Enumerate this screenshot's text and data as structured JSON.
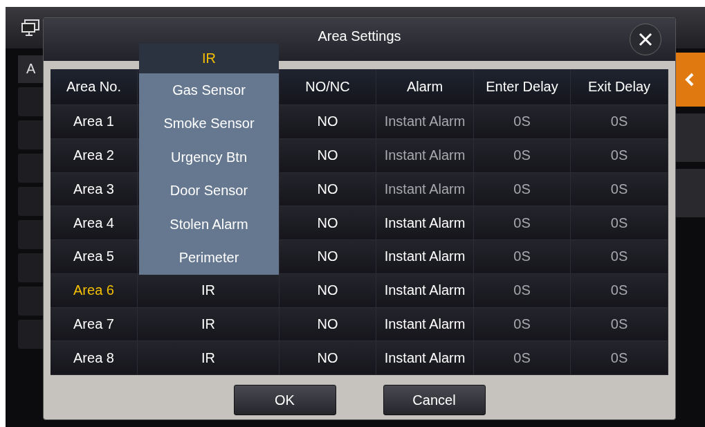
{
  "background": {
    "tab_label": "A"
  },
  "dialog": {
    "title": "Area Settings",
    "table": {
      "columns": [
        "Area No.",
        "NO/NC",
        "Alarm",
        "Enter Delay",
        "Exit Delay"
      ],
      "rows": [
        {
          "area": "Area 1",
          "no_nc": "NO",
          "alarm": {
            "text": "Instant Alarm",
            "dimmed": true
          },
          "enter_delay": "0S",
          "exit_delay": "0S",
          "selected": false
        },
        {
          "area": "Area 2",
          "no_nc": "NO",
          "alarm": {
            "text": "Instant Alarm",
            "dimmed": true
          },
          "enter_delay": "0S",
          "exit_delay": "0S",
          "selected": false
        },
        {
          "area": "Area 3",
          "no_nc": "NO",
          "alarm": {
            "text": "Instant Alarm",
            "dimmed": true
          },
          "enter_delay": "0S",
          "exit_delay": "0S",
          "selected": false
        },
        {
          "area": "Area 4",
          "no_nc": "NO",
          "alarm": {
            "text": "Instant Alarm",
            "dimmed": false
          },
          "enter_delay": "0S",
          "exit_delay": "0S",
          "selected": false
        },
        {
          "area": "Area 5",
          "no_nc": "NO",
          "alarm": {
            "text": "Instant Alarm",
            "dimmed": false
          },
          "enter_delay": "0S",
          "exit_delay": "0S",
          "selected": false
        },
        {
          "area": "Area 6",
          "type": "IR",
          "no_nc": "NO",
          "alarm": {
            "text": "Instant Alarm",
            "dimmed": false
          },
          "enter_delay": "0S",
          "exit_delay": "0S",
          "selected": true
        },
        {
          "area": "Area 7",
          "type": "IR",
          "no_nc": "NO",
          "alarm": {
            "text": "Instant Alarm",
            "dimmed": false
          },
          "enter_delay": "0S",
          "exit_delay": "0S",
          "selected": false
        },
        {
          "area": "Area 8",
          "type": "IR",
          "no_nc": "NO",
          "alarm": {
            "text": "Instant Alarm",
            "dimmed": false
          },
          "enter_delay": "0S",
          "exit_delay": "0S",
          "selected": false
        }
      ]
    },
    "dropdown": {
      "options": [
        {
          "label": "IR",
          "selected": true
        },
        {
          "label": "Gas Sensor",
          "selected": false
        },
        {
          "label": "Smoke Sensor",
          "selected": false
        },
        {
          "label": "Urgency Btn",
          "selected": false
        },
        {
          "label": "Door Sensor",
          "selected": false
        },
        {
          "label": "Stolen Alarm",
          "selected": false
        },
        {
          "label": "Perimeter",
          "selected": false
        }
      ]
    },
    "buttons": [
      "OK",
      "Cancel"
    ]
  }
}
